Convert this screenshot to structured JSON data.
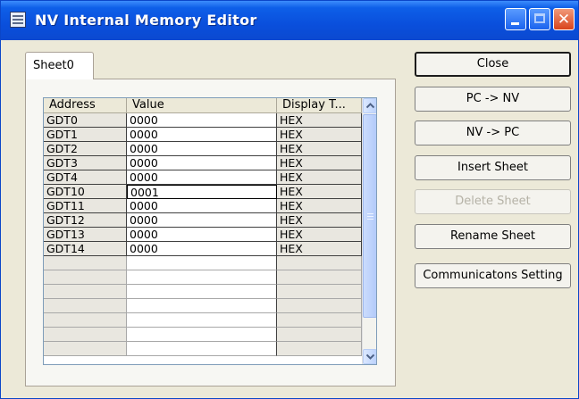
{
  "window": {
    "title": "NV Internal Memory Editor",
    "close_glyph": "✕"
  },
  "tabs": [
    {
      "label": "Sheet0",
      "selected": true
    }
  ],
  "grid": {
    "columns": [
      "Address",
      "Value",
      "Display T..."
    ],
    "rows": [
      {
        "address": "GDT0",
        "value": "0000",
        "display": "HEX"
      },
      {
        "address": "GDT1",
        "value": "0000",
        "display": "HEX"
      },
      {
        "address": "GDT2",
        "value": "0000",
        "display": "HEX"
      },
      {
        "address": "GDT3",
        "value": "0000",
        "display": "HEX"
      },
      {
        "address": "GDT4",
        "value": "0000",
        "display": "HEX"
      },
      {
        "address": "GDT10",
        "value": "0001",
        "display": "HEX",
        "editing": true
      },
      {
        "address": "GDT11",
        "value": "0000",
        "display": "HEX"
      },
      {
        "address": "GDT12",
        "value": "0000",
        "display": "HEX"
      },
      {
        "address": "GDT13",
        "value": "0000",
        "display": "HEX"
      },
      {
        "address": "GDT14",
        "value": "0000",
        "display": "HEX"
      }
    ],
    "empty_rows": 7
  },
  "buttons": {
    "close": "Close",
    "pc_to_nv": "PC -> NV",
    "nv_to_pc": "NV -> PC",
    "insert_sheet": "Insert Sheet",
    "delete_sheet": "Delete Sheet",
    "rename_sheet": "Rename Sheet",
    "communications_setting": "Communicatons Setting"
  },
  "icons": {
    "app": "memory-grid-icon",
    "minimize": "minimize-icon",
    "maximize": "maximize-icon",
    "close": "close-icon",
    "scroll_up": "chevron-up-icon",
    "scroll_down": "chevron-down-icon"
  },
  "colors": {
    "titlebar": "#0a4fdc",
    "window_bg": "#ece9d8",
    "close_button": "#d9441c",
    "disabled_text": "#b5b2a6"
  }
}
